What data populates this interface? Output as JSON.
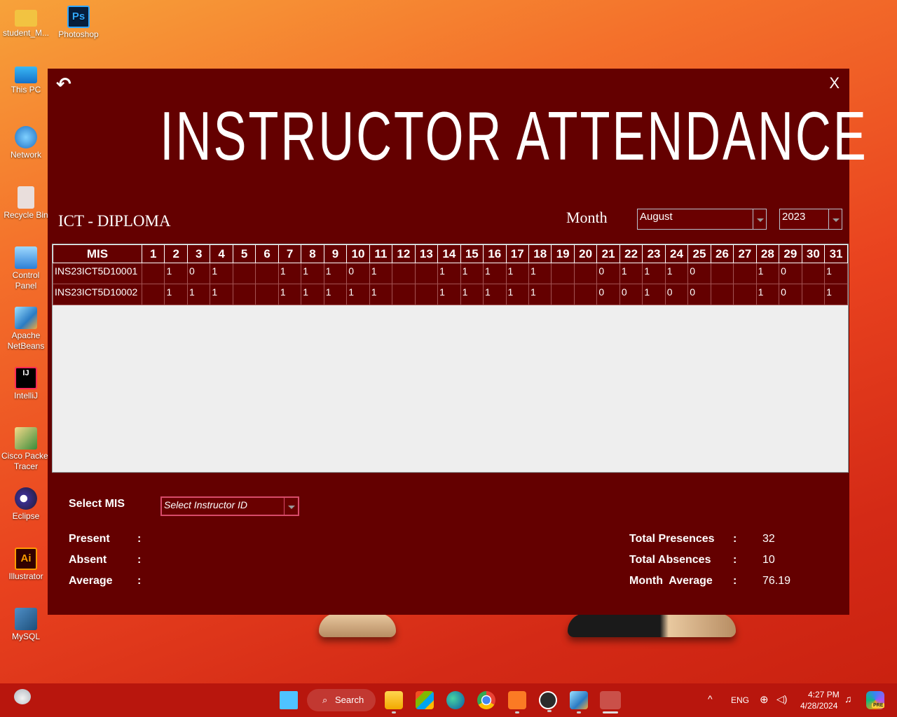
{
  "desktop": {
    "icons": [
      {
        "label": "student_M...",
        "icon": "folder-icon"
      },
      {
        "label": "Photoshop",
        "icon": "photoshop-icon"
      },
      {
        "label": "This PC",
        "icon": "monitor-icon"
      },
      {
        "label": "Network",
        "icon": "network-icon"
      },
      {
        "label": "Recycle Bin",
        "icon": "recycle-bin-icon"
      },
      {
        "label": "Control Panel",
        "icon": "control-panel-icon"
      },
      {
        "label": "Apache NetBeans",
        "icon": "netbeans-icon"
      },
      {
        "label": "IntelliJ",
        "icon": "intellij-icon"
      },
      {
        "label": "Cisco Packet Tracer",
        "icon": "packet-tracer-icon"
      },
      {
        "label": "Eclipse",
        "icon": "eclipse-icon"
      },
      {
        "label": "Illustrator",
        "icon": "illustrator-icon"
      },
      {
        "label": "MySQL",
        "icon": "mysql-icon"
      }
    ]
  },
  "window": {
    "back_glyph": "↶",
    "close_label": "X",
    "title": "INSTRUCTOR ATTENDANCE",
    "department": "ICT - DIPLOMA",
    "month_label": "Month",
    "month_value": "August",
    "year_value": "2023",
    "table": {
      "mis_header": "MIS",
      "days": [
        "1",
        "2",
        "3",
        "4",
        "5",
        "6",
        "7",
        "8",
        "9",
        "10",
        "11",
        "12",
        "13",
        "14",
        "15",
        "16",
        "17",
        "18",
        "19",
        "20",
        "21",
        "22",
        "23",
        "24",
        "25",
        "26",
        "27",
        "28",
        "29",
        "30",
        "31"
      ],
      "rows": [
        {
          "mis": "INS23ICT5D10001",
          "values": [
            "",
            "1",
            "0",
            "1",
            "",
            "",
            "1",
            "1",
            "1",
            "0",
            "1",
            "",
            "",
            "1",
            "1",
            "1",
            "1",
            "1",
            "",
            "",
            "0",
            "1",
            "1",
            "1",
            "0",
            "",
            "",
            "1",
            "0",
            "",
            "1"
          ]
        },
        {
          "mis": "INS23ICT5D10002",
          "values": [
            "",
            "1",
            "1",
            "1",
            "",
            "",
            "1",
            "1",
            "1",
            "1",
            "1",
            "",
            "",
            "1",
            "1",
            "1",
            "1",
            "1",
            "",
            "",
            "0",
            "0",
            "1",
            "0",
            "0",
            "",
            "",
            "1",
            "0",
            "",
            "1"
          ]
        }
      ]
    },
    "select_mis_label": "Select MIS",
    "select_mis_placeholder": "Select Instructor ID",
    "stats_left": {
      "present_label": "Present",
      "absent_label": "Absent",
      "average_label": "Average",
      "colon": ":"
    },
    "stats_right": {
      "total_presences_label": "Total Presences",
      "total_presences_value": "32",
      "total_absences_label": "Total Absences",
      "total_absences_value": "10",
      "month_average_label": "Month  Average",
      "month_average_value": "76.19",
      "colon": ":"
    }
  },
  "taskbar": {
    "search_label": "Search",
    "language": "ENG",
    "time": "4:27 PM",
    "date": "4/28/2024",
    "pre_badge": "PRE"
  },
  "colors": {
    "window_bg": "#640000",
    "accent_border": "#d84b6a",
    "taskbar_bg": "#b8160d"
  }
}
